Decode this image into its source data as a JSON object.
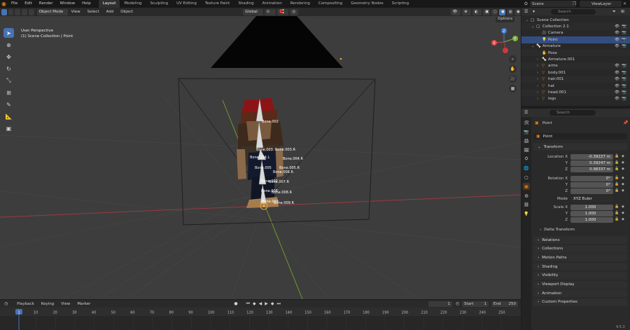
{
  "menu": [
    "File",
    "Edit",
    "Render",
    "Window",
    "Help"
  ],
  "workspaces": [
    "Layout",
    "Modeling",
    "Sculpting",
    "UV Editing",
    "Texture Paint",
    "Shading",
    "Animation",
    "Rendering",
    "Compositing",
    "Geometry Nodes",
    "Scripting"
  ],
  "active_workspace": "Layout",
  "scene_name": "Scene",
  "view_layer": "ViewLayer",
  "viewport_header": {
    "mode": "Object Mode",
    "menus": [
      "View",
      "Select",
      "Add",
      "Object"
    ],
    "orientation": "Global",
    "options_label": "Options"
  },
  "viewport": {
    "perspective_label": "User Perspective",
    "collection_label": "(1) Scene Collection | Point",
    "bone_labels": [
      "Bone.002",
      "Bone.003",
      "Bone.003.R",
      "Bone.004.L",
      "Bone.004.R",
      "Bone.005",
      "Bone.005.R",
      "Bone.006.R",
      "Bone.007",
      "Bone.007.R",
      "Bone.008",
      "Bone.008.R",
      "Bone.009",
      "Bone.009.R"
    ],
    "gizmo_axes": [
      "X",
      "Y",
      "Z"
    ]
  },
  "timeline": {
    "menus": [
      "Playback",
      "Keying",
      "View",
      "Marker"
    ],
    "current_frame": "1",
    "start_label": "Start",
    "start_value": "1",
    "end_label": "End",
    "end_value": "250",
    "ticks": [
      "1",
      "10",
      "20",
      "30",
      "40",
      "50",
      "60",
      "70",
      "80",
      "90",
      "100",
      "110",
      "120",
      "130",
      "140",
      "150",
      "160",
      "170",
      "180",
      "190",
      "200",
      "210",
      "220",
      "230",
      "240",
      "250"
    ]
  },
  "outliner": {
    "search_placeholder": "Search",
    "rows": [
      {
        "label": "Scene Collection",
        "indent": 0,
        "icon": "collection-icon"
      },
      {
        "label": "Collection 2.1",
        "indent": 1,
        "icon": "collection-icon"
      },
      {
        "label": "Camera",
        "indent": 2,
        "icon": "camera-icon"
      },
      {
        "label": "Point",
        "indent": 2,
        "icon": "light-icon"
      },
      {
        "label": "Armature",
        "indent": 1,
        "icon": "armature-icon"
      },
      {
        "label": "Pose",
        "indent": 2,
        "icon": "pose-icon"
      },
      {
        "label": "Armature.001",
        "indent": 2,
        "icon": "armature-data-icon"
      },
      {
        "label": "arms",
        "indent": 2,
        "icon": "mesh-icon"
      },
      {
        "label": "body.001",
        "indent": 2,
        "icon": "mesh-icon"
      },
      {
        "label": "hair.001",
        "indent": 2,
        "icon": "mesh-icon"
      },
      {
        "label": "hat",
        "indent": 2,
        "icon": "mesh-icon"
      },
      {
        "label": "head.001",
        "indent": 2,
        "icon": "mesh-icon"
      },
      {
        "label": "legs",
        "indent": 2,
        "icon": "mesh-icon"
      }
    ]
  },
  "properties": {
    "search_placeholder": "Search",
    "object_name": "Point",
    "data_name": "Point",
    "transform_label": "Transform",
    "location_label": "Location X",
    "location": [
      "-0.39227 m",
      "0.39247 m",
      "0.98337 m"
    ],
    "rotation_label": "Rotation X",
    "rotation": [
      "0°",
      "0°",
      "0°"
    ],
    "mode_label": "Mode",
    "mode_value": "XYZ Euler",
    "scale_label": "Scale X",
    "scale": [
      "1.000",
      "1.000",
      "1.000"
    ],
    "axis_y": "Y",
    "axis_z": "Z",
    "delta_transform": "Delta Transform",
    "panels": [
      "Relations",
      "Collections",
      "Motion Paths",
      "Shading",
      "Visibility",
      "Viewport Display",
      "Animation",
      "Custom Properties"
    ]
  },
  "version": "4.5.3",
  "colors": {
    "accent": "#4772b3",
    "selected_row": "#334d80",
    "orange": "#e87d0d"
  }
}
